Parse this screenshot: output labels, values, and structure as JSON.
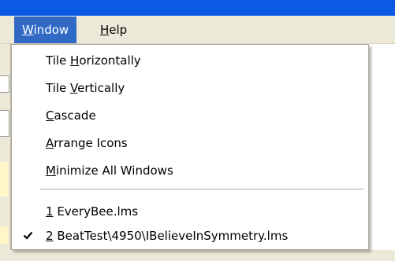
{
  "menubar": {
    "items": [
      {
        "mnemonic": "W",
        "rest": "indow",
        "open": true
      },
      {
        "mnemonic": "H",
        "rest": "elp",
        "open": false
      }
    ]
  },
  "window_menu": {
    "items": [
      {
        "before": "Tile ",
        "mnemonic": "H",
        "after": "orizontally"
      },
      {
        "before": "Tile ",
        "mnemonic": "V",
        "after": "ertically"
      },
      {
        "before": "",
        "mnemonic": "C",
        "after": "ascade"
      },
      {
        "before": "",
        "mnemonic": "A",
        "after": "rrange Icons"
      },
      {
        "before": "",
        "mnemonic": "M",
        "after": "inimize All Windows"
      }
    ],
    "windows": [
      {
        "before": "",
        "mnemonic": "1",
        "after": " EveryBee.lms",
        "checked": false
      },
      {
        "before": "",
        "mnemonic": "2",
        "after": " BeatTest\\4950\\IBelieveInSymmetry.lms",
        "checked": true
      }
    ]
  },
  "icons": {
    "checkmark": "check-icon"
  }
}
